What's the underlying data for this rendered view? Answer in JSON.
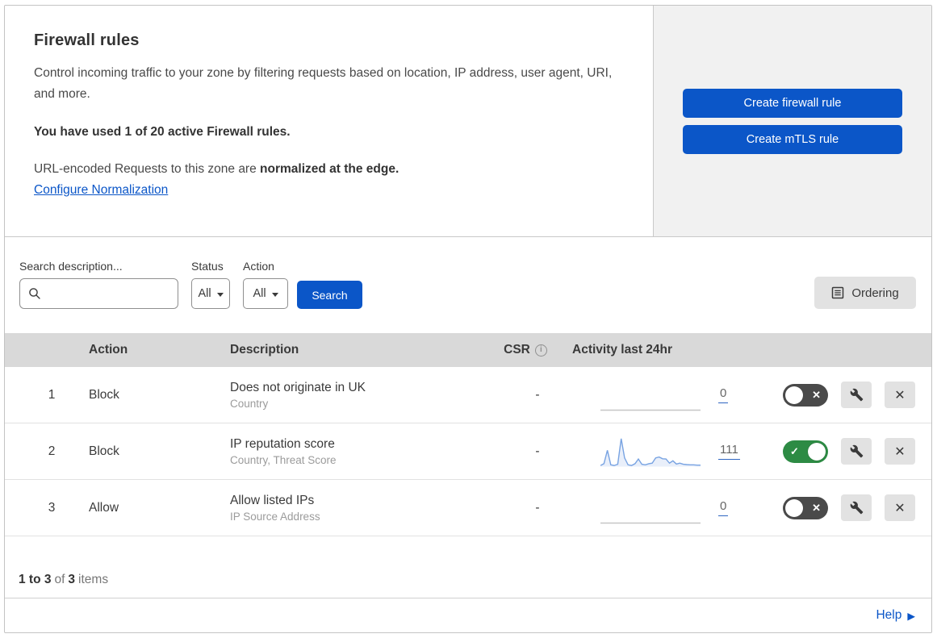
{
  "intro": {
    "title": "Firewall rules",
    "description": "Control incoming traffic to your zone by filtering requests based on location, IP address, user agent, URI, and more.",
    "usage": "You have used 1 of 20 active Firewall rules.",
    "normalization_prefix": "URL-encoded Requests to this zone are ",
    "normalization_bold": "normalized at the edge.",
    "configure_link": "Configure Normalization"
  },
  "actions": {
    "create_firewall_rule": "Create firewall rule",
    "create_mtls_rule": "Create mTLS rule"
  },
  "filters": {
    "search_label": "Search description...",
    "status_label": "Status",
    "status_value": "All",
    "action_label": "Action",
    "action_value": "All",
    "search_button": "Search",
    "ordering_button": "Ordering"
  },
  "table": {
    "headers": {
      "action": "Action",
      "description": "Description",
      "csr": "CSR",
      "activity": "Activity last 24hr"
    },
    "rows": [
      {
        "priority": "1",
        "action": "Block",
        "description": "Does not originate in UK",
        "fields": "Country",
        "csr": "-",
        "activity_count": "0",
        "enabled": false,
        "has_activity": false
      },
      {
        "priority": "2",
        "action": "Block",
        "description": "IP reputation score",
        "fields": "Country, Threat Score",
        "csr": "-",
        "activity_count": "111",
        "enabled": true,
        "has_activity": true
      },
      {
        "priority": "3",
        "action": "Allow",
        "description": "Allow listed IPs",
        "fields": "IP Source Address",
        "csr": "-",
        "activity_count": "0",
        "enabled": false,
        "has_activity": false
      }
    ]
  },
  "pagination": {
    "range": "1 to 3",
    "of": "of",
    "total": "3",
    "items_label": "items"
  },
  "help": {
    "label": "Help",
    "arrow": "▶"
  },
  "icons": {
    "info": "i",
    "close": "✕",
    "toggle_on_glyph": "✓",
    "toggle_off_glyph": "✕"
  },
  "colors": {
    "accent_blue": "#0b56c8",
    "link_blue": "#0b56c8",
    "toggle_on_green": "#2d8b44",
    "toggle_off_gray": "#4a4a4a",
    "sparkline_line": "#78a3e2",
    "sparkline_fill": "#e9effa",
    "empty_line": "#c6c6c6",
    "panel_gray": "#f1f1f1",
    "table_header_gray": "#d9d9d9"
  },
  "chart_data": {
    "type": "line",
    "context": "Activity last 24hr sparkline for rule 2 (IP reputation score), total shown: 111",
    "x": "last 24 hours, unlabeled relative time",
    "values": [
      4,
      10,
      56,
      6,
      4,
      8,
      96,
      30,
      6,
      4,
      10,
      26,
      8,
      6,
      10,
      12,
      30,
      33,
      27,
      26,
      12,
      20,
      9,
      12,
      8,
      7,
      6,
      6,
      5,
      5
    ],
    "ylim": [
      0,
      100
    ],
    "axes": "none (sparkline)",
    "legend": "none"
  }
}
